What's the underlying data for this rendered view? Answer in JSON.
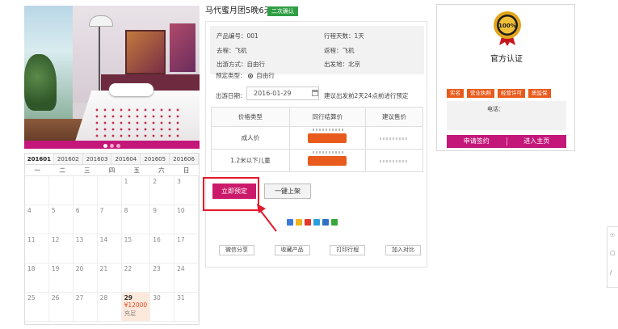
{
  "product": {
    "title": "马代蜜月团5晚6天",
    "badge": "二次确认"
  },
  "info": {
    "product_code": "产品编号：001",
    "days": "行程天数：1天",
    "departure_transport": "去程：飞机",
    "return_transport": "返程：飞机",
    "travel_mode": "出游方式：自由行",
    "departure_city": "出发地：北京"
  },
  "booking": {
    "type_label": "预定类型：",
    "type_value": "自由行",
    "date_label": "出游日期：",
    "date_value": "2016-01-29",
    "date_hint": "建议出发前2天24点前进行预定"
  },
  "price_table": {
    "headers": [
      "价格类型",
      "同行结算价",
      "建议售价"
    ],
    "rows": [
      {
        "type": "成人价"
      },
      {
        "type": "1.2米以下儿童"
      }
    ]
  },
  "buttons": {
    "reserve": "立即预定",
    "onekey": "一键上架",
    "wechat_share": "微信分享",
    "favorite": "收藏产品",
    "print": "打印行程",
    "compare": "加入对比"
  },
  "calendar": {
    "tabs": [
      "201601",
      "201602",
      "201603",
      "201604",
      "201605",
      "201606"
    ],
    "active_tab": "201601",
    "weekdays": [
      "一",
      "二",
      "三",
      "四",
      "五",
      "六",
      "日"
    ],
    "weeks": [
      [
        "",
        "",
        "",
        "",
        "1",
        "2",
        "3"
      ],
      [
        "4",
        "5",
        "6",
        "7",
        "8",
        "9",
        "10"
      ],
      [
        "11",
        "12",
        "13",
        "14",
        "15",
        "16",
        "17"
      ],
      [
        "18",
        "19",
        "20",
        "21",
        "22",
        "23",
        "24"
      ],
      [
        "25",
        "26",
        "27",
        "28",
        "29",
        "30",
        "31"
      ]
    ],
    "highlight": {
      "day": "29",
      "price": "¥12000",
      "status": "充足"
    }
  },
  "official": {
    "seal_text": "100%",
    "title": "官方认证",
    "certs": [
      "实名",
      "营业执照",
      "经营许可",
      "质监保"
    ],
    "phone_label": "电话：",
    "apply": "申请签约",
    "home": "进入主页"
  },
  "sidebar": {
    "icons": [
      "share-icon",
      "comment-icon",
      "edit-icon"
    ]
  },
  "colors": {
    "accent": "#c4177a",
    "orange": "#e85b1c",
    "green": "#2f9e44",
    "red_highlight": "#e3192b"
  }
}
